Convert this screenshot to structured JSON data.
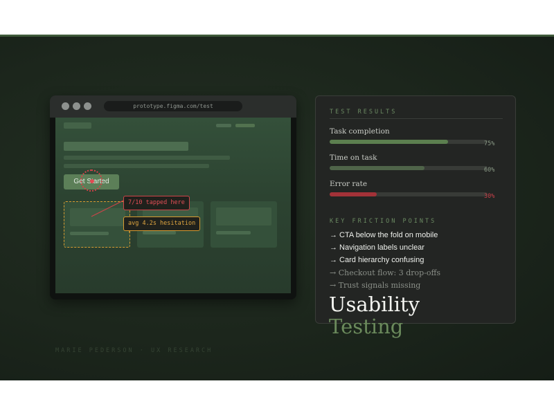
{
  "browser": {
    "url": "prototype.figma.com/test",
    "cta_label": "Get Started",
    "callouts": {
      "tap": "7/10 tapped here",
      "hesitation": "avg 4.2s hesitation"
    }
  },
  "results": {
    "heading": "TEST RESULTS",
    "metrics": [
      {
        "label": "Task completion",
        "value_text": "75%",
        "value": 0.75,
        "color": "#5c7f4f",
        "text_color": "#8a9a86"
      },
      {
        "label": "Time on task",
        "value_text": "60%",
        "value": 0.6,
        "color": "#4f6449",
        "text_color": "#8a9a86"
      },
      {
        "label": "Error rate",
        "value_text": "30%",
        "value": 0.3,
        "color": "#a33238",
        "text_color": "#c8414a"
      }
    ],
    "friction_heading": "KEY FRICTION POINTS",
    "friction_points": [
      {
        "text": "→ CTA below the fold on mobile",
        "emphasis": "high"
      },
      {
        "text": "→ Navigation labels unclear",
        "emphasis": "high"
      },
      {
        "text": "→ Card hierarchy confusing",
        "emphasis": "high"
      },
      {
        "text": "→ Checkout flow: 3 drop-offs",
        "emphasis": "low"
      },
      {
        "text": "→ Trust signals missing",
        "emphasis": "low"
      }
    ]
  },
  "title": {
    "line1": "Usability",
    "line2": "Testing"
  },
  "footer": "MARIE PEDERSON · UX RESEARCH",
  "colors": {
    "accent_green": "#6b8a5c",
    "alert_red": "#d6434a",
    "highlight_orange": "#d99b30"
  }
}
